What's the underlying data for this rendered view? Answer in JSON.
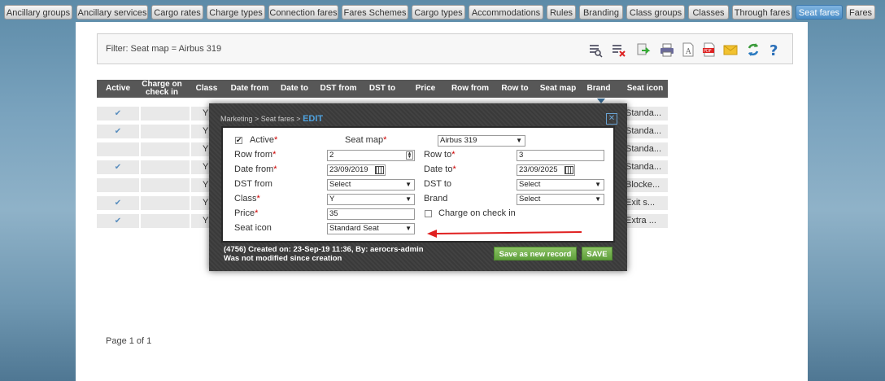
{
  "tabs": [
    "Ancillary groups",
    "Ancillary services",
    "Cargo rates",
    "Charge types",
    "Connection fares",
    "Fares Schemes",
    "Cargo types",
    "Accommodations",
    "Rules",
    "Branding",
    "Class groups",
    "Classes",
    "Through fares",
    "Seat fares",
    "Fares"
  ],
  "active_tab": "Seat fares",
  "filter": {
    "text": "Filter: Seat map = Airbus 319"
  },
  "toolbar_icons": [
    "search-list-icon",
    "clear-filter-icon",
    "export-icon",
    "print-icon",
    "text-file-icon",
    "pdf-icon",
    "email-icon",
    "refresh-icon",
    "help-icon"
  ],
  "table": {
    "headers": [
      "Active",
      "Charge on check in",
      "Class",
      "Date from",
      "Date to",
      "DST from",
      "DST to",
      "Price",
      "Row from",
      "Row to",
      "Seat map",
      "Brand",
      "Seat icon"
    ],
    "rows": [
      {
        "active": "✔",
        "class": "Y",
        "seat_icon": "Standa..."
      },
      {
        "active": "✔",
        "class": "Y",
        "seat_icon": "Standa..."
      },
      {
        "active": "",
        "class": "Y",
        "seat_icon": "Standa..."
      },
      {
        "active": "✔",
        "class": "Y",
        "seat_icon": "Standa..."
      },
      {
        "active": "",
        "class": "Y",
        "seat_icon": "Blocke..."
      },
      {
        "active": "✔",
        "class": "Y",
        "seat_icon": "Exit s..."
      },
      {
        "active": "✔",
        "class": "Y",
        "seat_icon": "Extra ..."
      }
    ]
  },
  "pager": "Page 1 of 1",
  "modal": {
    "breadcrumb": "Marketing > Seat fares > ",
    "mode": "EDIT",
    "close": "✕",
    "fields": {
      "active_label": "Active",
      "active_checked": "✔",
      "seat_map_label": "Seat map",
      "seat_map_value": "Airbus 319",
      "row_from_label": "Row from",
      "row_from_value": "2",
      "row_to_label": "Row to",
      "row_to_value": "3",
      "date_from_label": "Date from",
      "date_from_value": "23/09/2019",
      "date_to_label": "Date to",
      "date_to_value": "23/09/2025",
      "dst_from_label": "DST from",
      "dst_from_value": "Select",
      "dst_to_label": "DST to",
      "dst_to_value": "Select",
      "class_label": "Class",
      "class_value": "Y",
      "brand_label": "Brand",
      "brand_value": "Select",
      "price_label": "Price",
      "price_value": "35",
      "charge_label": "Charge on check in",
      "seat_icon_label": "Seat icon",
      "seat_icon_value": "Standard Seat",
      "required_mark": "*"
    },
    "footer_line1": "(4756) Created on: 23-Sep-19 11:36, By: aerocrs-admin",
    "footer_line2": "Was not modified since creation",
    "save_new_label": "Save as new record",
    "save_label": "SAVE"
  },
  "colors": {
    "accent": "#4a8cc6",
    "header_bg": "#575757",
    "save_green": "#6aa84f",
    "required": "#cc0000",
    "arrow_red": "#e02020"
  }
}
